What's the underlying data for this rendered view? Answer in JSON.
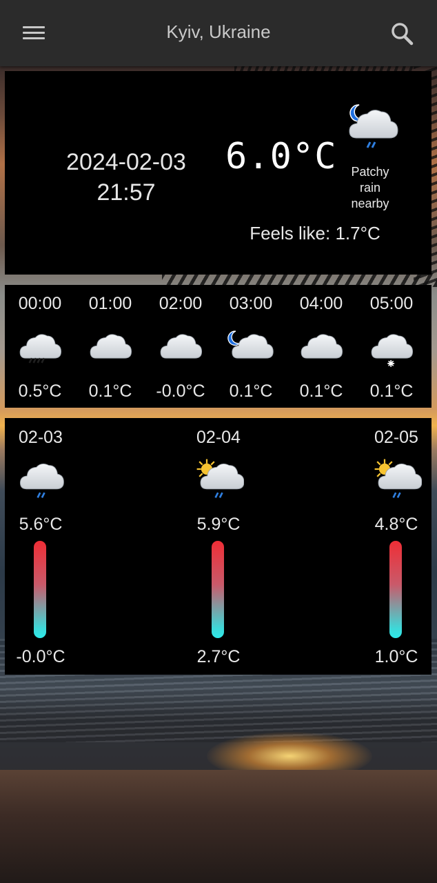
{
  "app_bar": {
    "title": "Kyiv, Ukraine",
    "menu_icon": "hamburger-menu-icon",
    "search_icon": "search-icon"
  },
  "current": {
    "date": "2024-02-03",
    "time": "21:57",
    "temperature": "6.0°C",
    "condition_line1": "Patchy",
    "condition_line2": "rain",
    "condition_line3": "nearby",
    "icon": "moon-cloud-rain-icon",
    "feels_like": "Feels like: 1.7°C"
  },
  "hourly": [
    {
      "time": "00:00",
      "icon": "cloud-rain-icon",
      "temp": "0.5°C"
    },
    {
      "time": "01:00",
      "icon": "cloud-icon",
      "temp": "0.1°C"
    },
    {
      "time": "02:00",
      "icon": "cloud-icon",
      "temp": "-0.0°C"
    },
    {
      "time": "03:00",
      "icon": "moon-cloud-icon",
      "temp": "0.1°C"
    },
    {
      "time": "04:00",
      "icon": "cloud-icon",
      "temp": "0.1°C"
    },
    {
      "time": "05:00",
      "icon": "cloud-snow-icon",
      "temp": "0.1°C"
    }
  ],
  "daily": [
    {
      "date": "02-03",
      "icon": "cloud-rain-icon",
      "high": "5.6°C",
      "low": "-0.0°C"
    },
    {
      "date": "02-04",
      "icon": "sun-cloud-rain-icon",
      "high": "5.9°C",
      "low": "2.7°C"
    },
    {
      "date": "02-05",
      "icon": "sun-cloud-rain-icon",
      "high": "4.8°C",
      "low": "1.0°C"
    }
  ],
  "colors": {
    "app_bar": "#2b2b2b",
    "card": "#000000",
    "bar_hot": "#ef2e36",
    "bar_cold": "#2ee9e9",
    "rain": "#2f7fe0",
    "moon": "#1e6fe0",
    "sun": "#f7c431"
  }
}
